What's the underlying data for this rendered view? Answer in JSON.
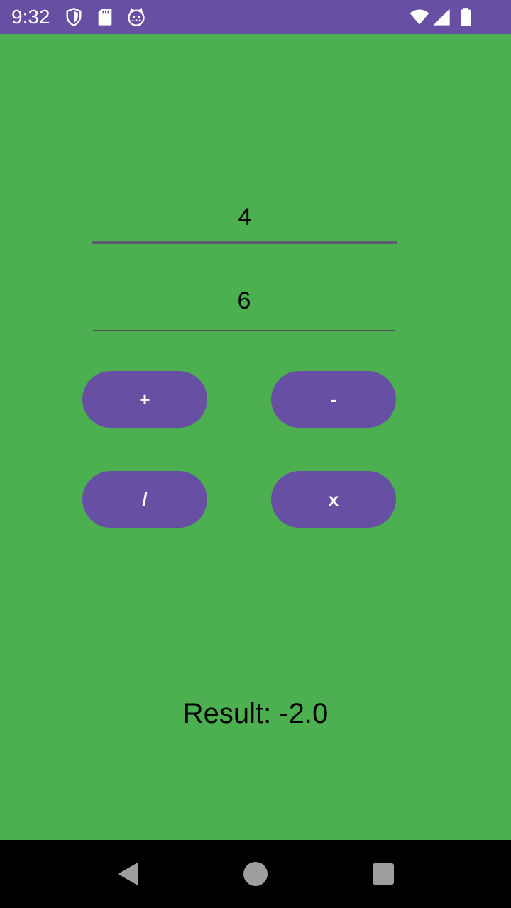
{
  "status_bar": {
    "time": "9:32",
    "background_color": "#6750A4",
    "left_icons": [
      "shield-icon",
      "sd-card-icon",
      "cat-icon"
    ],
    "right_icons": [
      "wifi-icon",
      "cell-signal-icon",
      "battery-icon"
    ]
  },
  "calculator": {
    "first_number": "4",
    "second_number": "6",
    "buttons": {
      "add": "+",
      "subtract": "-",
      "divide": "/",
      "multiply": "x"
    },
    "result_text": "Result: -2.0",
    "background_color": "#4CAF50",
    "button_color": "#6750A4"
  },
  "nav_bar": {
    "icons": [
      "back-icon",
      "home-icon",
      "recents-icon"
    ]
  }
}
